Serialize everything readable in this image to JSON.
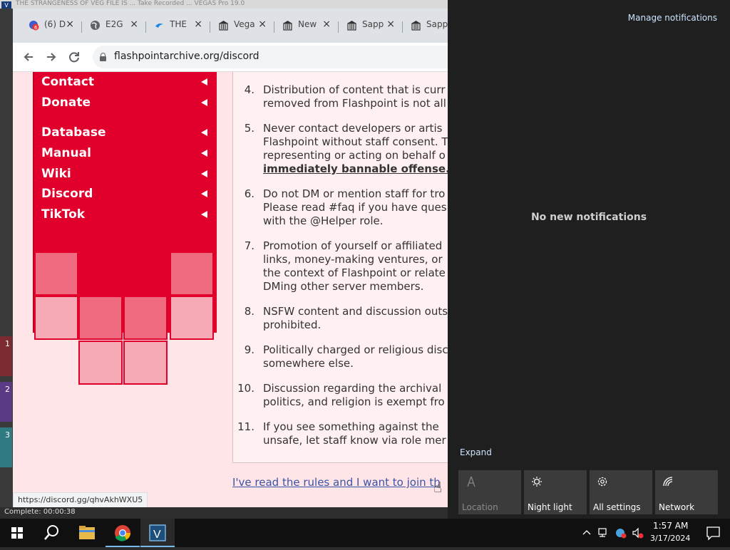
{
  "vegas": {
    "title": "THE STRANGENESS OF VEG FILE IS ... Take Recorded ... VEGAS Pro 19.0",
    "complete_text": "Complete: 00:00:38",
    "track_numbers": [
      "1",
      "2",
      "3"
    ]
  },
  "browser": {
    "tabs": [
      {
        "label": "(6) D",
        "icon": "youtube-notification-icon",
        "badge": "6"
      },
      {
        "label": "E2G",
        "icon": "globe-icon"
      },
      {
        "label": "THE",
        "icon": "blue-wave-icon"
      },
      {
        "label": "Vega",
        "icon": "museum-icon"
      },
      {
        "label": "New",
        "icon": "museum-icon"
      },
      {
        "label": "Sapp",
        "icon": "museum-icon"
      },
      {
        "label": "Sapp",
        "icon": "museum-icon"
      }
    ],
    "url": "flashpointarchive.org/discord",
    "status_url": "https://discord.gg/qhvAkhWXU5"
  },
  "sidebar": {
    "items": [
      "Contact",
      "Donate",
      "Database",
      "Manual",
      "Wiki",
      "Discord",
      "TikTok"
    ]
  },
  "rules": [
    {
      "num": "4.",
      "lines": [
        "Distribution of content that is curr",
        "removed from Flashpoint is not all"
      ]
    },
    {
      "num": "5.",
      "lines": [
        "Never contact developers or artis",
        "Flashpoint without staff consent. T",
        "representing or acting on behalf o",
        "immediately bannable offense."
      ]
    },
    {
      "num": "6.",
      "lines": [
        "Do not DM or mention staff for tro",
        "Please read #faq if you have ques",
        "with the @Helper role."
      ]
    },
    {
      "num": "7.",
      "lines": [
        "Promotion of yourself or affiliated",
        "links, money-making ventures, or",
        "the context of Flashpoint or relate",
        "DMing other server members."
      ]
    },
    {
      "num": "8.",
      "lines": [
        "NSFW content and discussion outs",
        "prohibited."
      ]
    },
    {
      "num": "9.",
      "lines": [
        "Politically charged or religious disc",
        "somewhere else."
      ]
    },
    {
      "num": "10.",
      "lines": [
        "Discussion regarding the archival",
        "politics, and religion is exempt fro"
      ]
    },
    {
      "num": "11.",
      "lines": [
        "If you see something against the",
        "unsafe, let staff know via role mer"
      ]
    }
  ],
  "join_link": "I've read the rules and I want to join th",
  "action_center": {
    "manage": "Manage notifications",
    "empty": "No new notifications",
    "expand": "Expand",
    "tiles": [
      {
        "label": "Location",
        "icon": "location-icon",
        "enabled": false
      },
      {
        "label": "Night light",
        "icon": "night-light-icon",
        "enabled": true
      },
      {
        "label": "All settings",
        "icon": "gear-icon",
        "enabled": true
      },
      {
        "label": "Network",
        "icon": "network-icon",
        "enabled": true
      }
    ]
  },
  "taskbar": {
    "time": "1:57 AM",
    "date": "3/17/2024"
  }
}
